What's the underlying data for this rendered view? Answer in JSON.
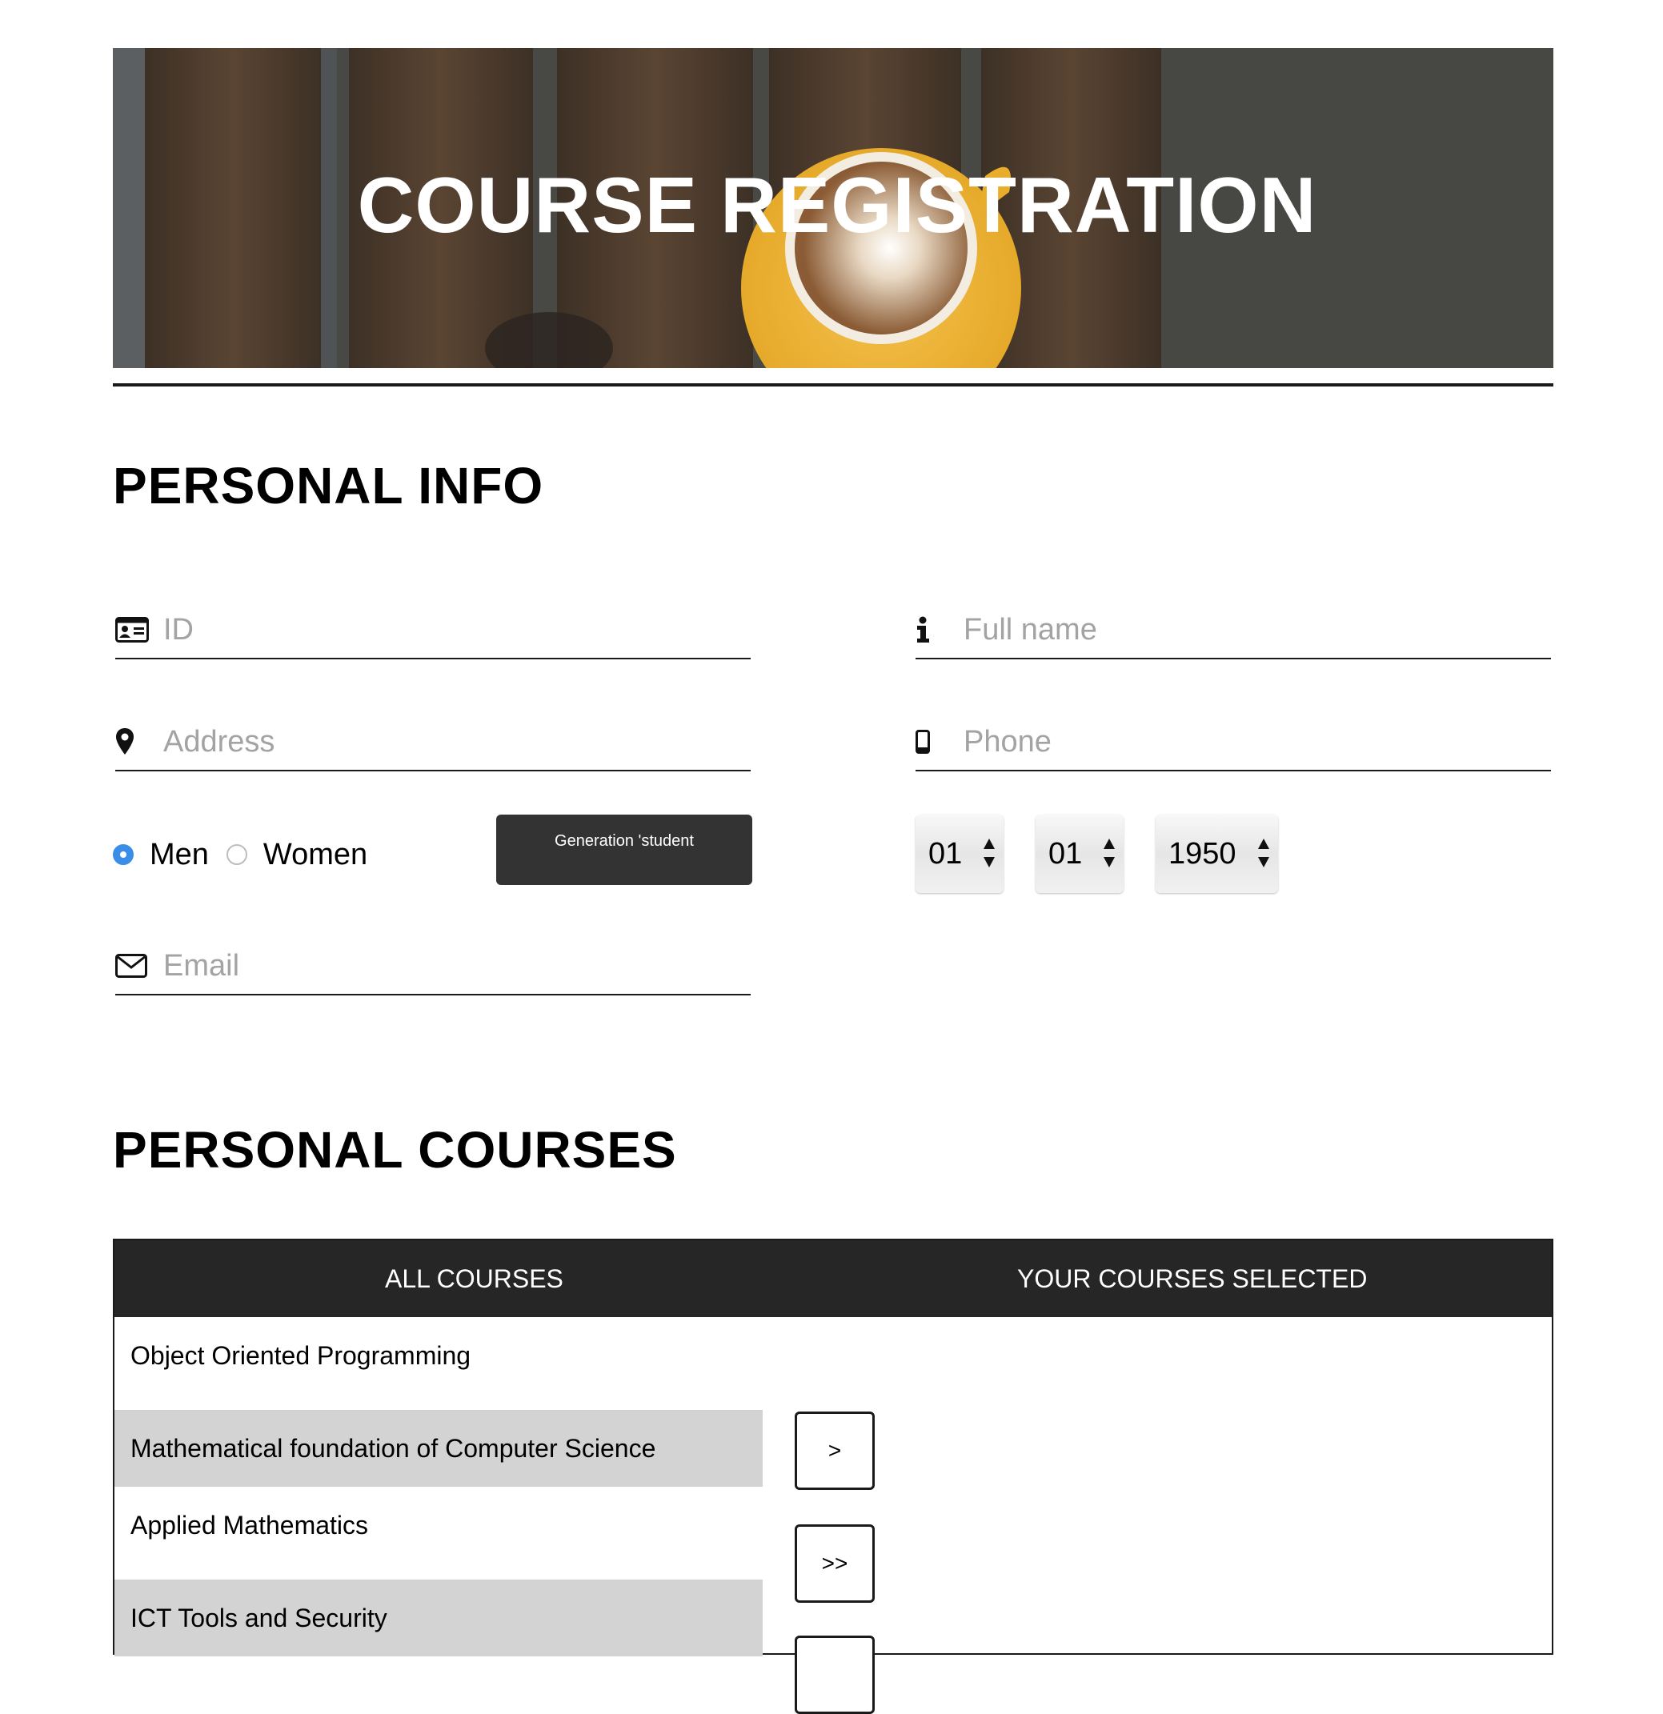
{
  "header": {
    "title": "COURSE REGISTRATION"
  },
  "personal_info": {
    "heading": "PERSONAL INFO",
    "fields": {
      "id": {
        "placeholder": "ID",
        "icon": "id-card-icon"
      },
      "full_name": {
        "placeholder": "Full name",
        "icon": "info-icon"
      },
      "address": {
        "placeholder": "Address",
        "icon": "map-marker-icon"
      },
      "phone": {
        "placeholder": "Phone",
        "icon": "mobile-phone-icon"
      },
      "email": {
        "placeholder": "Email",
        "icon": "envelope-icon"
      }
    },
    "gender": {
      "options": [
        "Men",
        "Women"
      ],
      "selected": "Men"
    },
    "generate_button": "Generation 'student",
    "birth_date": {
      "day": "01",
      "month": "01",
      "year": "1950"
    }
  },
  "personal_courses": {
    "heading": "PERSONAL COURSES",
    "columns": [
      "ALL COURSES",
      "YOUR COURSES SELECTED"
    ],
    "all_courses": [
      "Object Oriented Programming",
      "Mathematical foundation of Computer Science",
      "Applied Mathematics",
      "ICT Tools and Security"
    ],
    "selected_courses": [],
    "move_buttons": [
      ">",
      ">>"
    ]
  },
  "colors": {
    "radio_selected": "#3b8ee8",
    "button_dark": "#333333",
    "table_header": "#262626",
    "row_shaded": "#d3d3d3"
  }
}
